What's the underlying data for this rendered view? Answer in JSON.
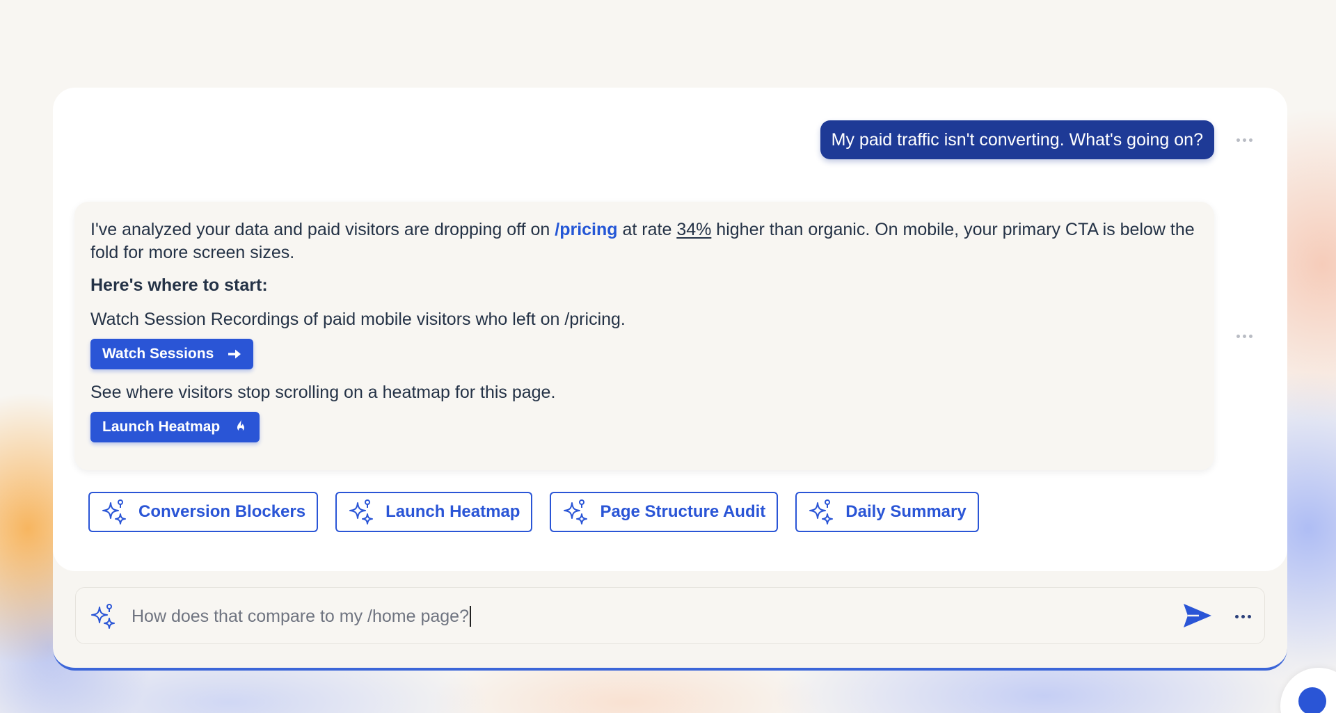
{
  "colors": {
    "brand_blue": "#2a55d6",
    "user_bubble": "#1e3a96",
    "text_dark": "#243246",
    "link_blue": "#2557d6"
  },
  "chat": {
    "user_message": "My paid traffic isn't converting. What's going on?",
    "assistant": {
      "intro_part1": "I've analyzed your data and paid visitors are dropping off on ",
      "intro_link": "/pricing",
      "intro_part2": " at rate ",
      "intro_stat": "34%",
      "intro_part3": " higher than organic. On mobile, your primary CTA is below the fold for more screen sizes.",
      "heading": "Here's where to start:",
      "steps": [
        {
          "text": "Watch Session Recordings of paid mobile visitors who left on /pricing.",
          "button_label": "Watch Sessions",
          "button_icon": "arrow-right-icon"
        },
        {
          "text": "See where visitors stop scrolling on a heatmap for this page.",
          "button_label": "Launch Heatmap",
          "button_icon": "flame-icon"
        }
      ]
    }
  },
  "suggestions": [
    {
      "label": "Conversion Blockers",
      "icon": "sparkle-icon"
    },
    {
      "label": "Launch Heatmap",
      "icon": "sparkle-icon"
    },
    {
      "label": "Page Structure Audit",
      "icon": "sparkle-icon"
    },
    {
      "label": "Daily Summary",
      "icon": "sparkle-icon"
    }
  ],
  "composer": {
    "value": "How does that compare to my /home page?",
    "send_icon": "send-icon",
    "more_icon": "more-horizontal-icon"
  }
}
